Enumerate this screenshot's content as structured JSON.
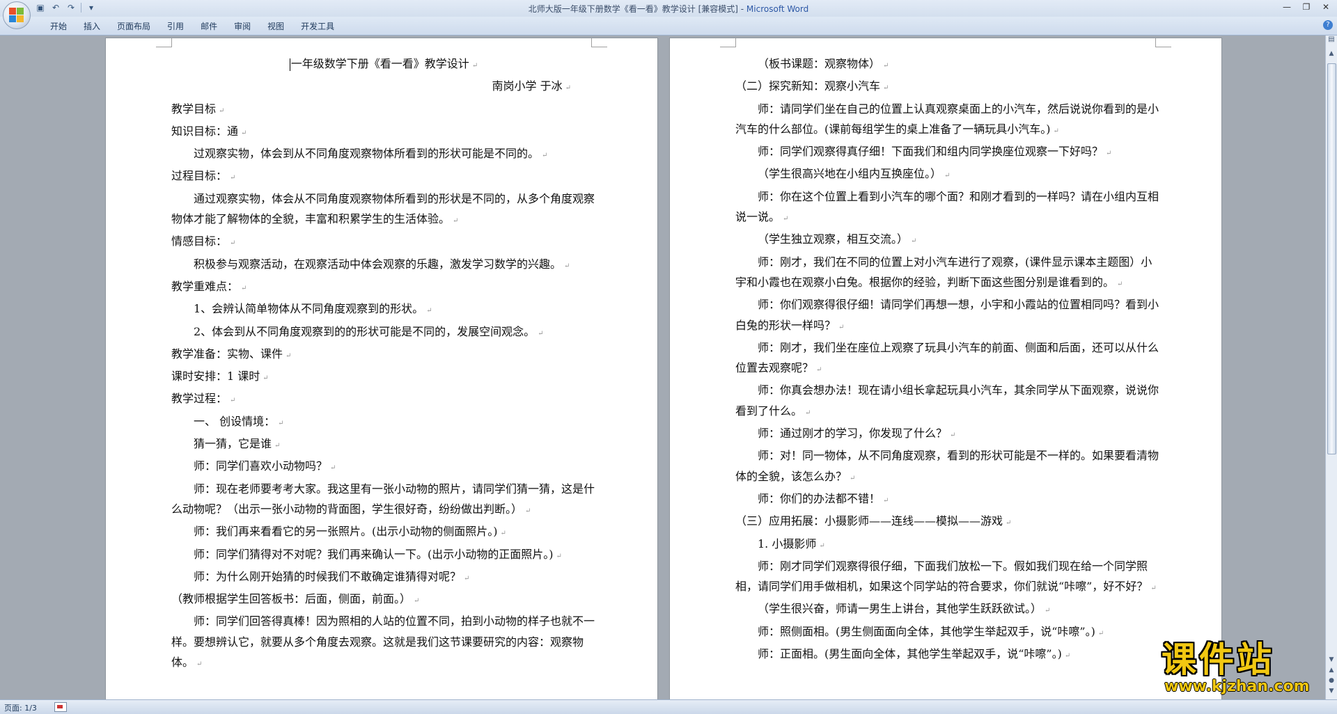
{
  "window": {
    "title_doc": "北师大版一年级下册数学《看一看》教学设计 [兼容模式] - ",
    "title_app": "Microsoft Word"
  },
  "quick_access": {
    "icons": [
      "save-icon",
      "undo-icon",
      "redo-icon",
      "customize-qat-icon"
    ]
  },
  "ribbon": {
    "tabs": [
      "开始",
      "插入",
      "页面布局",
      "引用",
      "邮件",
      "审阅",
      "视图",
      "开发工具"
    ]
  },
  "page1": {
    "paragraphs": [
      {
        "text": "一年级数学下册《看一看》教学设计",
        "style": "center"
      },
      {
        "text": "南岗小学    于冰",
        "style": "right"
      },
      {
        "text": "教学目标",
        "style": ""
      },
      {
        "text": "知识目标：通",
        "style": ""
      },
      {
        "text": "过观察实物，体会到从不同角度观察物体所看到的形状可能是不同的。",
        "style": "ind"
      },
      {
        "text": "过程目标：",
        "style": ""
      },
      {
        "text": "通过观察实物，体会从不同角度观察物体所看到的形状是不同的，从多个角度观察物体才能了解物体的全貌，丰富和积累学生的生活体验。",
        "style": "ind"
      },
      {
        "text": "情感目标：",
        "style": ""
      },
      {
        "text": "积极参与观察活动，在观察活动中体会观察的乐趣，激发学习数学的兴趣。",
        "style": "ind"
      },
      {
        "text": "教学重难点：",
        "style": ""
      },
      {
        "text": "1、会辨认简单物体从不同角度观察到的形状。",
        "style": "ind"
      },
      {
        "text": "2、体会到从不同角度观察到的的形状可能是不同的，发展空间观念。",
        "style": "ind"
      },
      {
        "text": "教学准备：实物、课件",
        "style": ""
      },
      {
        "text": "课时安排：1 课时",
        "style": ""
      },
      {
        "text": "教学过程：",
        "style": ""
      },
      {
        "text": "一、  创设情境：",
        "style": "ind"
      },
      {
        "text": "猜一猜，它是谁",
        "style": "ind"
      },
      {
        "text": "师：同学们喜欢小动物吗？",
        "style": "ind"
      },
      {
        "text": "师：现在老师要考考大家。我这里有一张小动物的照片，请同学们猜一猜，这是什么动物呢？（出示一张小动物的背面图，学生很好奇，纷纷做出判断。）",
        "style": "ind"
      },
      {
        "text": "师：我们再来看看它的另一张照片。(出示小动物的侧面照片。)",
        "style": "ind"
      },
      {
        "text": "师：同学们猜得对不对呢？我们再来确认一下。(出示小动物的正面照片。)",
        "style": "ind"
      },
      {
        "text": "师：为什么刚开始猜的时候我们不敢确定谁猜得对呢？",
        "style": "ind"
      },
      {
        "text": "（教师根据学生回答板书：后面，侧面，前面。）",
        "style": ""
      },
      {
        "text": "师：同学们回答得真棒！因为照相的人站的位置不同，拍到小动物的样子也就不一样。要想辨认它，就要从多个角度去观察。这就是我们这节课要研究的内容：观察物体。",
        "style": "ind"
      }
    ]
  },
  "page2": {
    "paragraphs": [
      {
        "text": "（板书课题：观察物体）",
        "style": "ind"
      },
      {
        "text": "（二）探究新知：观察小汽车",
        "style": ""
      },
      {
        "text": "师：请同学们坐在自己的位置上认真观察桌面上的小汽车，然后说说你看到的是小汽车的什么部位。(课前每组学生的桌上准备了一辆玩具小汽车。)",
        "style": "ind"
      },
      {
        "text": "师：同学们观察得真仔细！下面我们和组内同学换座位观察一下好吗？",
        "style": "ind"
      },
      {
        "text": "（学生很高兴地在小组内互换座位。）",
        "style": "ind"
      },
      {
        "text": "师：你在这个位置上看到小汽车的哪个面？和刚才看到的一样吗？请在小组内互相说一说。",
        "style": "ind"
      },
      {
        "text": "（学生独立观察，相互交流。）",
        "style": "ind"
      },
      {
        "text": "师：刚才，我们在不同的位置上对小汽车进行了观察，(课件显示课本主题图）小宇和小霞也在观察小白兔。根据你的经验，判断下面这些图分别是谁看到的。",
        "style": "ind"
      },
      {
        "text": "师：你们观察得很仔细！请同学们再想一想，小宇和小霞站的位置相同吗？看到小白兔的形状一样吗？",
        "style": "ind"
      },
      {
        "text": "师：刚才，我们坐在座位上观察了玩具小汽车的前面、侧面和后面，还可以从什么位置去观察呢？",
        "style": "ind"
      },
      {
        "text": "师：你真会想办法！现在请小组长拿起玩具小汽车，其余同学从下面观察，说说你看到了什么。",
        "style": "ind"
      },
      {
        "text": "师：通过刚才的学习，你发现了什么？",
        "style": "ind"
      },
      {
        "text": "师：对！同一物体，从不同角度观察，看到的形状可能是不一样的。如果要看清物体的全貌，该怎么办？",
        "style": "ind"
      },
      {
        "text": "师：你们的办法都不错！",
        "style": "ind"
      },
      {
        "text": "（三）应用拓展：小摄影师——连线——模拟——游戏",
        "style": ""
      },
      {
        "text": "1. 小摄影师",
        "style": "ind"
      },
      {
        "text": "师：刚才同学们观察得很仔细，下面我们放松一下。假如我们现在给一个同学照相，请同学们用手做相机，如果这个同学站的符合要求，你们就说“咔嚓”，好不好？",
        "style": "ind"
      },
      {
        "text": "（学生很兴奋，师请一男生上讲台，其他学生跃跃欲试。）",
        "style": "ind"
      },
      {
        "text": "师：照侧面相。(男生侧面面向全体，其他学生举起双手，说“咔嚓”。)",
        "style": "ind"
      },
      {
        "text": "师：正面相。(男生面向全体，其他学生举起双手，说“咔嚓”。)",
        "style": "ind"
      }
    ]
  },
  "statusbar": {
    "page_info": "页面: 1/3"
  },
  "watermark": {
    "logo": "课件站",
    "url": "www.kjzhan.com"
  }
}
